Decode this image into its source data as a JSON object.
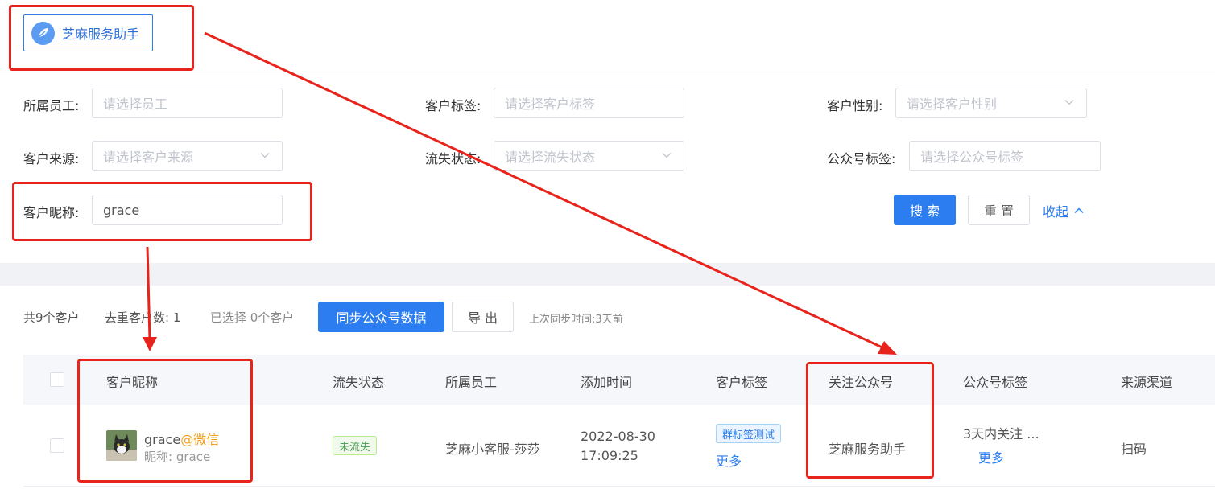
{
  "app_chip": {
    "label": "芝麻服务助手"
  },
  "filters": {
    "employee": {
      "label": "所属员工:",
      "placeholder": "请选择员工"
    },
    "customer_tag": {
      "label": "客户标签:",
      "placeholder": "请选择客户标签"
    },
    "gender": {
      "label": "客户性别:",
      "placeholder": "请选择客户性别"
    },
    "source": {
      "label": "客户来源:",
      "placeholder": "请选择客户来源"
    },
    "churn_status": {
      "label": "流失状态:",
      "placeholder": "请选择流失状态"
    },
    "oa_tag": {
      "label": "公众号标签:",
      "placeholder": "请选择公众号标签"
    },
    "nickname": {
      "label": "客户昵称:",
      "value": "grace"
    }
  },
  "actions": {
    "search": "搜 索",
    "reset": "重 置",
    "collapse": "收起"
  },
  "toolbar": {
    "total": "共9个客户",
    "dedup": "去重客户数:  1",
    "selected": "已选择 0个客户",
    "sync": "同步公众号数据",
    "export": "导 出",
    "last_sync": "上次同步时间:3天前"
  },
  "table": {
    "columns": [
      "客户昵称",
      "流失状态",
      "所属员工",
      "添加时间",
      "客户标签",
      "关注公众号",
      "公众号标签",
      "来源渠道"
    ],
    "rows": [
      {
        "nickname_main": "grace",
        "nickname_platform": "@微信",
        "nickname_sub": "昵称:  grace",
        "churn": "未流失",
        "employee": "芝麻小客服-莎莎",
        "added_date": "2022-08-30",
        "added_time": "17:09:25",
        "tag": "群标签测试",
        "tag_more": "更多",
        "official_account": "芝麻服务助手",
        "oa_tag": "3天内关注 ...",
        "oa_tag_more": "更多",
        "channel": "扫码"
      }
    ]
  },
  "colors": {
    "primary": "#2b7df0",
    "annotation": "#e8231c",
    "accent": "#f0a020"
  }
}
